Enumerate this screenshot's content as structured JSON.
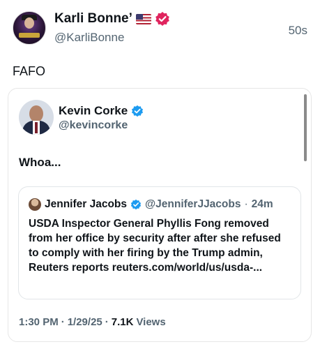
{
  "outer_post": {
    "display_name": "Karli Bonne’",
    "handle": "@KarliBonne",
    "timestamp": "50s",
    "text": "FAFO",
    "avatar_text": "Mission Failed"
  },
  "quoted_post": {
    "display_name": "Kevin Corke",
    "handle": "@kevincorke",
    "text": "Whoa...",
    "meta": {
      "time": "1:30 PM",
      "sep1": "·",
      "date": "1/29/25",
      "sep2": "·",
      "views_count": "7.1K",
      "views_label": "Views"
    }
  },
  "nested_post": {
    "display_name": "Jennifer Jacobs",
    "handle": "@JenniferJJacobs",
    "sep": "·",
    "time": "24m",
    "text": "USDA Inspector General Phyllis Fong removed from her office by security after after she refused to comply with her firing by the Trump admin, Reuters reports reuters.com/world/us/usda-..."
  },
  "colors": {
    "pink_badge": "#e0245e",
    "blue_badge": "#1d9bf0",
    "secondary_text": "#536471"
  }
}
